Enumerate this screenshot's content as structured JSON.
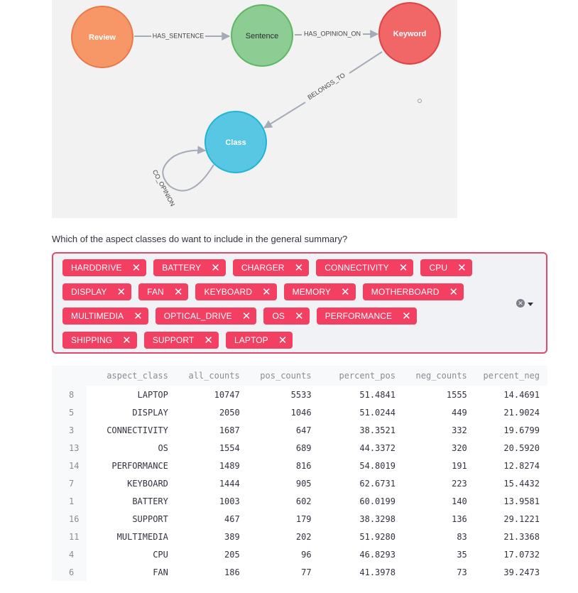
{
  "graph": {
    "nodes": [
      {
        "id": "review",
        "label": "Review",
        "color": "#f79767",
        "stroke": "#e87a4a",
        "text_color": "#ffffff"
      },
      {
        "id": "sentence",
        "label": "Sentence",
        "color": "#8dcc93",
        "stroke": "#5db665",
        "text_color": "#2a2c34"
      },
      {
        "id": "keyword",
        "label": "Keyword",
        "color": "#f16667",
        "stroke": "#dc4345",
        "text_color": "#ffffff"
      },
      {
        "id": "class",
        "label": "Class",
        "color": "#57c7e3",
        "stroke": "#23b3d7",
        "text_color": "#ffffff"
      }
    ],
    "edges": [
      {
        "from": "review",
        "to": "sentence",
        "label": "HAS_SENTENCE"
      },
      {
        "from": "sentence",
        "to": "keyword",
        "label": "HAS_OPINION_ON"
      },
      {
        "from": "keyword",
        "to": "class",
        "label": "BELONGS_TO"
      },
      {
        "from": "class",
        "to": "class",
        "label": "CO_OPINION"
      }
    ]
  },
  "question": "Which of the aspect classes do want to include in the general summary?",
  "multiselect": {
    "selected": [
      "HARDDRIVE",
      "BATTERY",
      "CHARGER",
      "CONNECTIVITY",
      "CPU",
      "DISPLAY",
      "FAN",
      "KEYBOARD",
      "MEMORY",
      "MOTHERBOARD",
      "MULTIMEDIA",
      "OPTICAL_DRIVE",
      "OS",
      "PERFORMANCE",
      "SHIPPING",
      "SUPPORT",
      "LAPTOP"
    ],
    "remove_glyph": "✕",
    "clear_glyph": "✕",
    "accent_color": "#f23f62"
  },
  "table": {
    "columns": [
      "aspect_class",
      "all_counts",
      "pos_counts",
      "percent_pos",
      "neg_counts",
      "percent_neg"
    ],
    "rows": [
      {
        "index": "8",
        "cells": [
          "LAPTOP",
          "10747",
          "5533",
          "51.4841",
          "1555",
          "14.4691"
        ]
      },
      {
        "index": "5",
        "cells": [
          "DISPLAY",
          "2050",
          "1046",
          "51.0244",
          "449",
          "21.9024"
        ]
      },
      {
        "index": "3",
        "cells": [
          "CONNECTIVITY",
          "1687",
          "647",
          "38.3521",
          "332",
          "19.6799"
        ]
      },
      {
        "index": "13",
        "cells": [
          "OS",
          "1554",
          "689",
          "44.3372",
          "320",
          "20.5920"
        ]
      },
      {
        "index": "14",
        "cells": [
          "PERFORMANCE",
          "1489",
          "816",
          "54.8019",
          "191",
          "12.8274"
        ]
      },
      {
        "index": "7",
        "cells": [
          "KEYBOARD",
          "1444",
          "905",
          "62.6731",
          "223",
          "15.4432"
        ]
      },
      {
        "index": "1",
        "cells": [
          "BATTERY",
          "1003",
          "602",
          "60.0199",
          "140",
          "13.9581"
        ]
      },
      {
        "index": "16",
        "cells": [
          "SUPPORT",
          "467",
          "179",
          "38.3298",
          "136",
          "29.1221"
        ]
      },
      {
        "index": "11",
        "cells": [
          "MULTIMEDIA",
          "389",
          "202",
          "51.9280",
          "83",
          "21.3368"
        ]
      },
      {
        "index": "4",
        "cells": [
          "CPU",
          "205",
          "96",
          "46.8293",
          "35",
          "17.0732"
        ]
      },
      {
        "index": "6",
        "cells": [
          "FAN",
          "186",
          "77",
          "41.3978",
          "73",
          "39.2473"
        ]
      }
    ]
  }
}
